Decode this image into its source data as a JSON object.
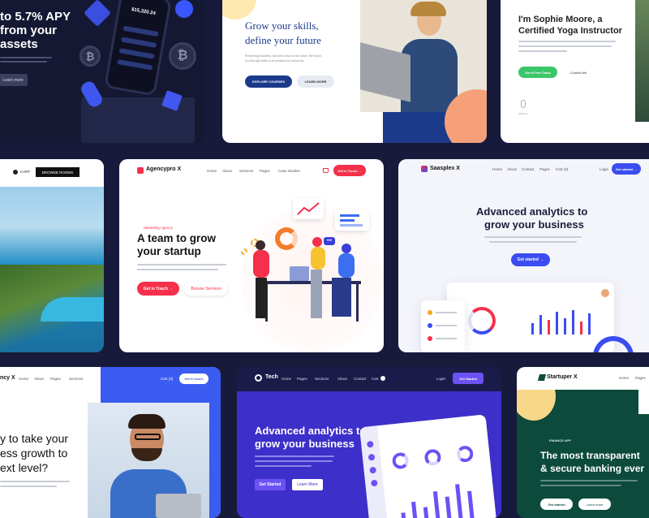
{
  "crypto": {
    "h1": "to 5.7% APY",
    "h2": "from your",
    "h3": "assets",
    "btn": "Learn more",
    "balance": "$15,320.24"
  },
  "skills": {
    "h1": "Grow your skills,",
    "h2": "define your future",
    "body1": "Presenting Academy, the tech school of the future. We teach",
    "body2": "you the right skills to be prepared for tomorrow.",
    "primary": "EXPLORE COURSES",
    "secondary": "LEARN MORE"
  },
  "yoga": {
    "h1": "I'm Sophie Moore, a",
    "h2": "Certified Yoga Instructor",
    "primary": "Get a Free Class",
    "secondary": "Contact Me",
    "scroll": "SCROLL"
  },
  "hotel": {
    "cart": "CART",
    "browse": "BROWSE ROOMS"
  },
  "agency": {
    "logo": "Agencypro X",
    "nav": [
      "Home",
      "About",
      "Services",
      "Pages",
      "Case Studies"
    ],
    "nav_btn": "Get in Touch →",
    "tag": "Marketing Agency",
    "h1": "A team to grow",
    "h2": "your startup",
    "primary": "Get in Touch →",
    "secondary": "Browse Services"
  },
  "saas": {
    "logo": "Saasplex X",
    "nav": [
      "Home",
      "About",
      "Contact",
      "Pages",
      "Cart (3)"
    ],
    "login": "Login",
    "nav_btn": "Get started →",
    "h1": "Advanced analytics to",
    "h2": "grow your business",
    "btn": "Get started →"
  },
  "growth": {
    "logo": "ncy X",
    "nav": [
      "Home",
      "About",
      "Pages",
      "Services"
    ],
    "cart": "Cart (3)",
    "nav_btn": "Get in touch",
    "h1": "y to take your",
    "h2": "ess growth to",
    "h3": "ext level?"
  },
  "tech": {
    "logo": "Tech",
    "nav": [
      "Home",
      "Pages",
      "Sections",
      "About",
      "Contact",
      "Cart"
    ],
    "login": "Login",
    "nav_btn": "Get Started",
    "h1": "Advanced analytics to",
    "h2": "grow your business",
    "primary": "Get Started",
    "secondary": "Learn More"
  },
  "startuper": {
    "logo": "Startuper X",
    "nav": [
      "Home",
      "Pages"
    ],
    "tag": "FINANCE APP",
    "h1": "The most transparent",
    "h2": "& secure banking ever",
    "primary": "Get started",
    "secondary": "Learn more"
  },
  "colors": {
    "bg": "#171a3a",
    "navy": "#1c3a8a",
    "agency_red": "#f5304a",
    "saas_blue": "#3b4df0",
    "tech_purple": "#3d2fc9",
    "startuper_green": "#0c4a3c",
    "yoga_green": "#3cc66a"
  }
}
